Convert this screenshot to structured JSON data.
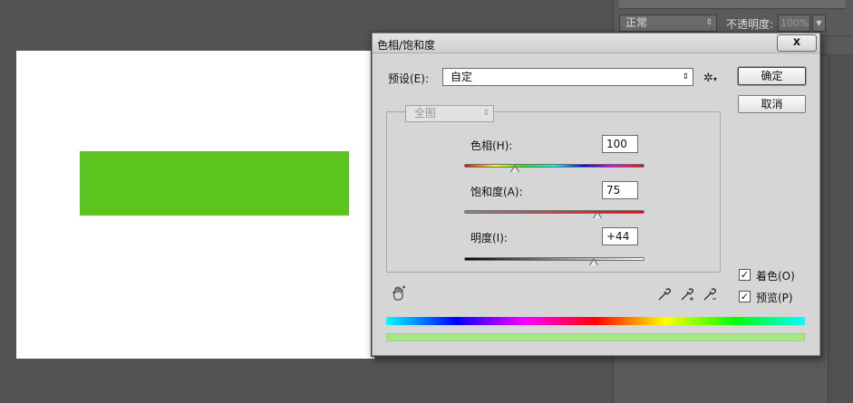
{
  "background_panel": {
    "blend_mode": "正常",
    "opacity_label": "不透明度:",
    "opacity_value": "100%"
  },
  "canvas": {
    "shape_color": "#5bc41f"
  },
  "dialog": {
    "title": "色相/饱和度",
    "close_label": "x",
    "preset_label": "预设(E):",
    "preset_value": "自定",
    "ok_label": "确定",
    "cancel_label": "取消",
    "channel_value": "全图",
    "hue": {
      "label": "色相(H):",
      "value": "100",
      "fraction": 0.28
    },
    "saturation": {
      "label": "饱和度(A):",
      "value": "75",
      "fraction": 0.74
    },
    "lightness": {
      "label": "明度(I):",
      "value": "+44",
      "fraction": 0.72
    },
    "colorize": {
      "label": "着色(O)",
      "checked": true
    },
    "preview": {
      "label": "预览(P)",
      "checked": true
    },
    "result_color": "#a6e889"
  }
}
